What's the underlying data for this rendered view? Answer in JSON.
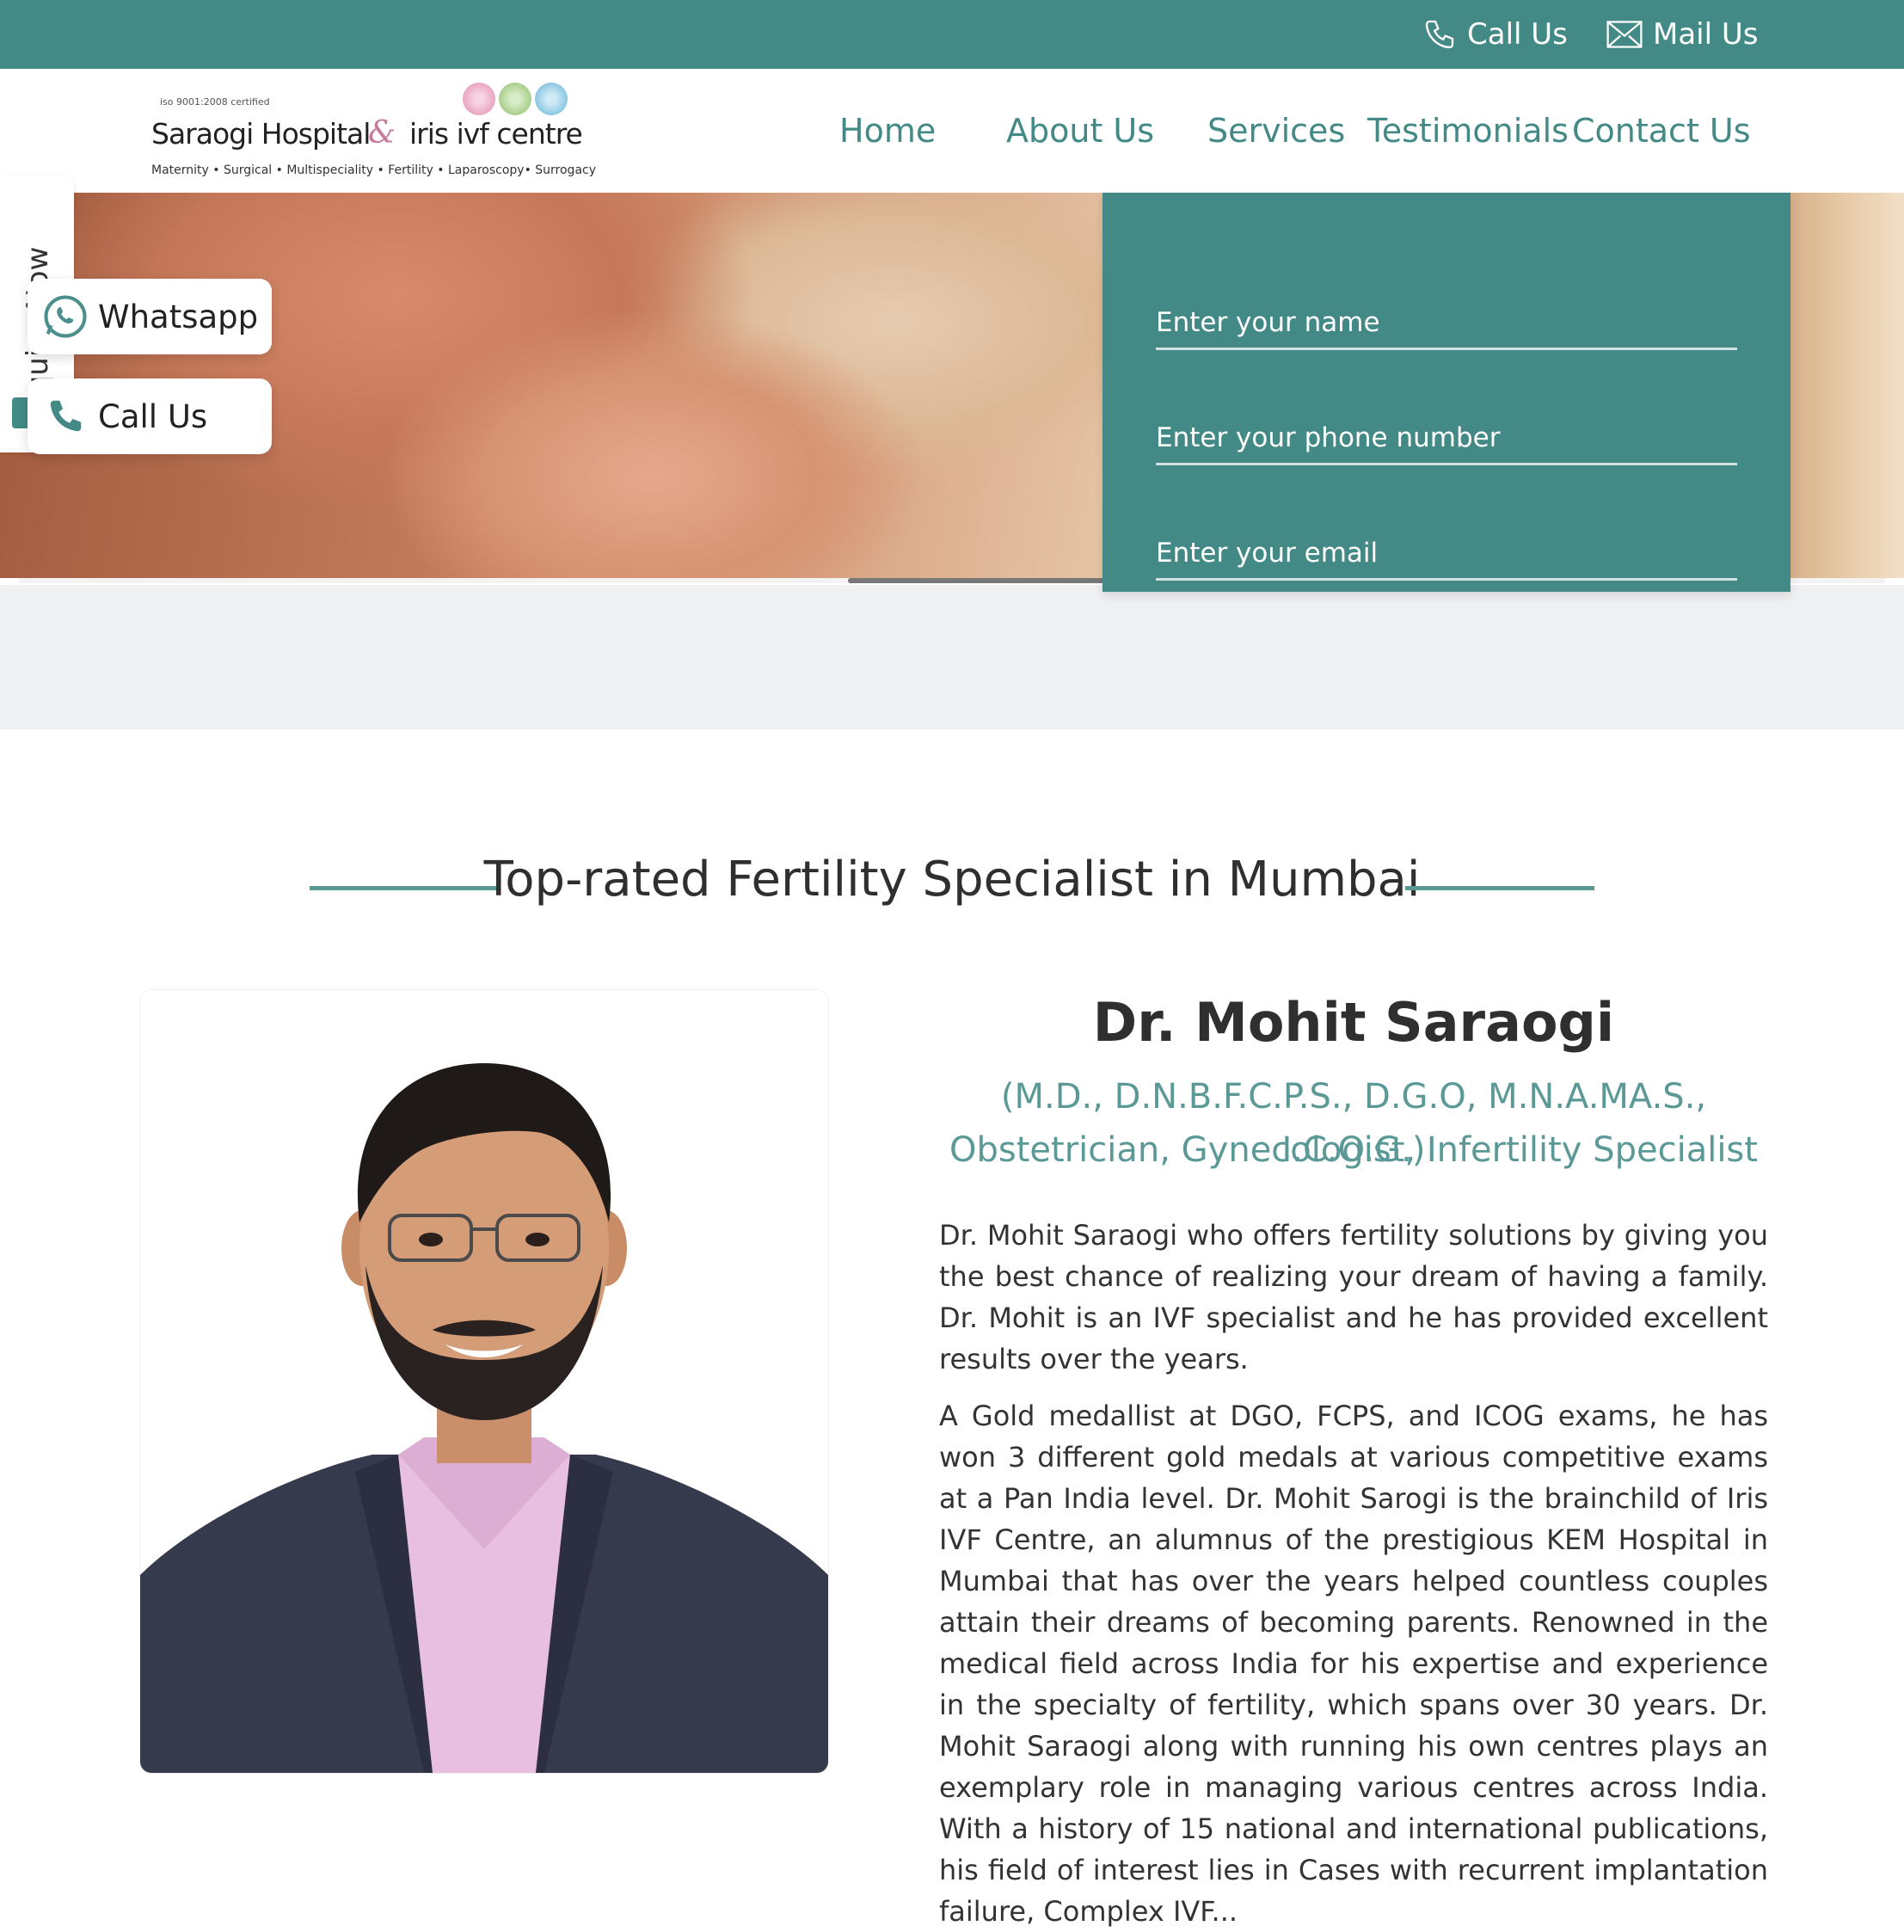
{
  "topbar": {
    "call_label": "Call Us",
    "mail_label": "Mail Us"
  },
  "logo": {
    "iso_text": "iso 9001:2008 certified",
    "hospital_name": "Saraogi Hospital",
    "ampersand": "&",
    "centre_name": "iris ivf centre",
    "tagline": "Maternity • Surgical • Multispeciality •  Fertility • Laparoscopy• Surrogacy",
    "flower_colors": [
      "#e9a6c2",
      "#a9cf8a",
      "#8cc7e3"
    ]
  },
  "nav": {
    "items": [
      "Home",
      "About Us",
      "Services",
      "Testimonials",
      "Contact Us"
    ]
  },
  "enquiry_form": {
    "name_placeholder": "Enter your name",
    "phone_placeholder": "Enter your phone number",
    "email_placeholder": "Enter your email"
  },
  "side": {
    "enquire_label": "Enquire Now",
    "whatsapp_label": "Whatsapp",
    "call_label": "Call Us"
  },
  "section": {
    "title": "Top-rated Fertility Specialist in Mumbai"
  },
  "doctor": {
    "name": "Dr. Mohit Saraogi",
    "qualifications": "(M.D., D.N.B.F.C.P.S., D.G.O, M.N.A.MA.S., I.C.O.G.)",
    "specialty": "Obstetrician, Gynecologist, Infertility Specialist",
    "bio_1": "Dr. Mohit Saraogi who offers fertility solutions by giving you the best chance of realizing your dream of having a family. Dr. Mohit is an IVF specialist and he has provided excellent results over the years.",
    "bio_2": "A Gold medallist at DGO, FCPS, and ICOG exams, he has won 3 different gold medals at various competitive exams at a Pan India level. Dr. Mohit Sarogi is the brainchild of Iris IVF Centre, an alumnus of the prestigious KEM Hospital in Mumbai that has over the years helped countless couples attain their dreams of becoming parents. Renowned in the medical field across India for his expertise and experience in the specialty of fertility, which spans over 30 years. Dr. Mohit Saraogi along with running his own centres plays an exemplary role in managing various centres across India. With a history of 15 national and international publications, his field of interest lies in Cases with recurrent implantation failure, Complex IVF..."
  },
  "colors": {
    "brand": "#438a86",
    "accent": "#5a9996",
    "text": "#2f2f2f"
  }
}
